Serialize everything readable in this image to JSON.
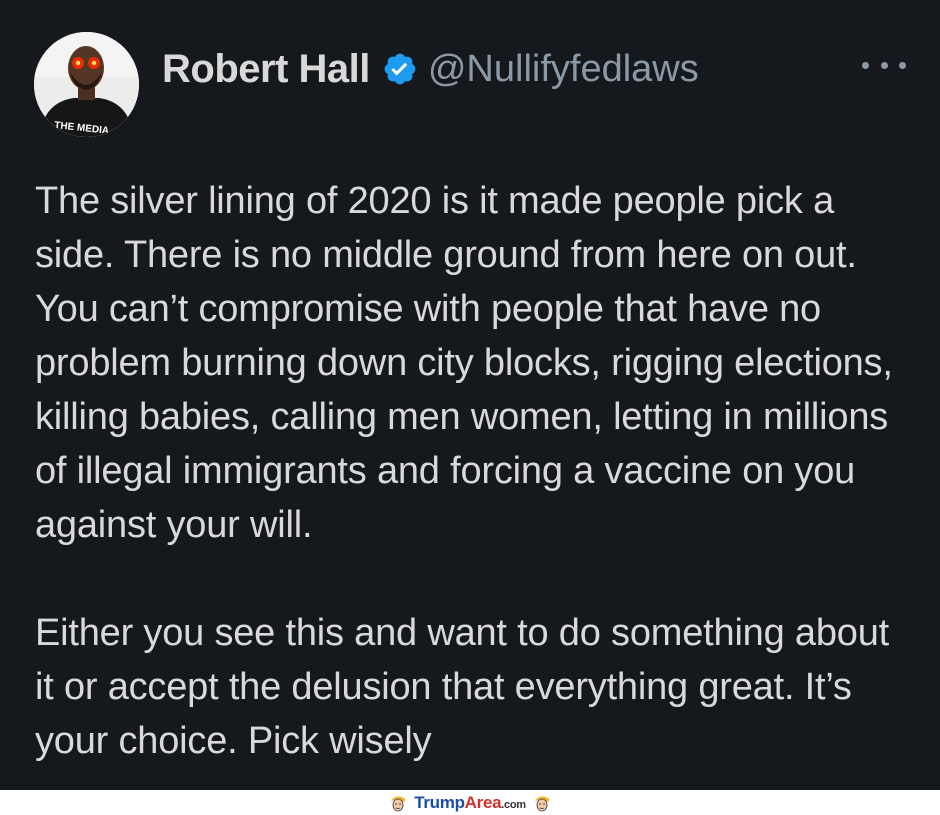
{
  "tweet": {
    "display_name": "Robert Hall",
    "handle": "@Nullifyfedlaws",
    "avatar_shirt_text": "THE MEDIA",
    "paragraphs": [
      "The silver lining of 2020 is it made people pick a side. There is no middle ground from here on out. You can’t compromise with people that have no problem burning down city blocks, rigging elections, killing babies, calling men women, letting in millions of illegal immigrants and forcing a vaccine on you against your will.",
      "Either you see this and want to do something about it or accept the delusion that everything great. It’s your choice. Pick wisely"
    ],
    "icons": {
      "verified": "verified-badge-icon",
      "more": "more-options-icon"
    },
    "colors": {
      "background": "#15181c",
      "text": "#d9d9d9",
      "handle": "#8b98a5",
      "verified": "#1d9bf0"
    }
  },
  "watermark": {
    "brand_part1": "Trump",
    "brand_part2": "Area",
    "brand_suffix": ".com"
  }
}
